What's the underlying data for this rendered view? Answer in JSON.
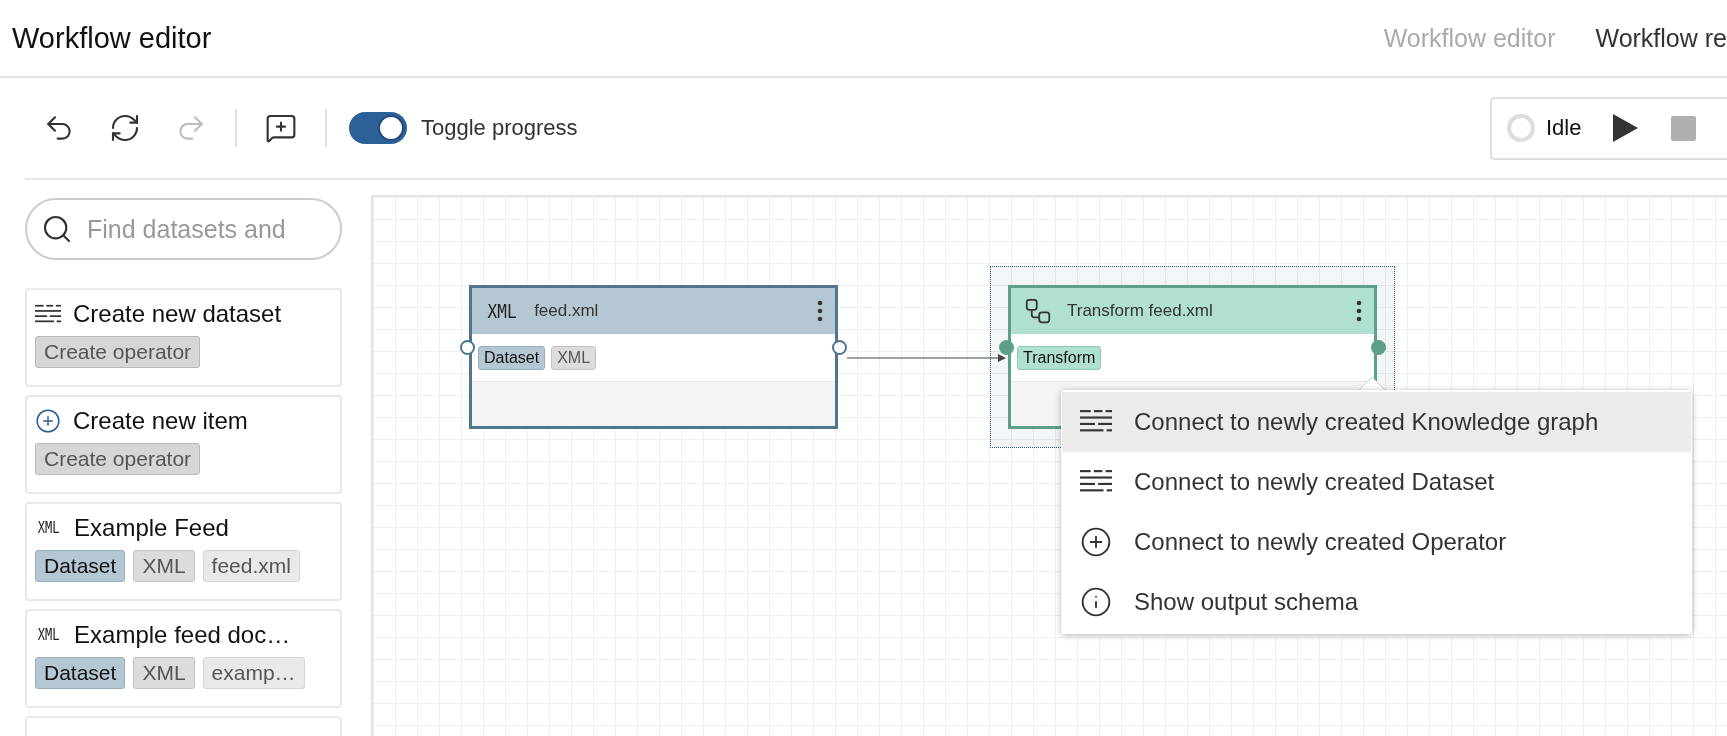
{
  "header": {
    "title": "Workflow editor",
    "tabs": [
      {
        "label": "Workflow editor",
        "selected": false
      },
      {
        "label": "Workflow re",
        "selected": true
      }
    ]
  },
  "toolbar": {
    "tools": [
      {
        "kind": "undo",
        "disabled": false
      },
      {
        "kind": "refresh",
        "disabled": false
      },
      {
        "kind": "redo",
        "disabled": true
      },
      {
        "kind": "comment",
        "disabled": false
      }
    ],
    "toggle": {
      "label": "Toggle progress",
      "on": true
    },
    "status": {
      "label": "Idle"
    }
  },
  "sidebar": {
    "search": {
      "placeholder": "Find datasets and"
    },
    "items": [
      {
        "kind": "dataset",
        "title": "Create new dataset",
        "tags": [
          {
            "kind": "operator",
            "label": "Create operator"
          }
        ]
      },
      {
        "kind": "create",
        "title": "Create new item",
        "tags": [
          {
            "kind": "operator",
            "label": "Create operator"
          }
        ]
      },
      {
        "kind": "xml",
        "icon_text": "XML",
        "title": "Example Feed",
        "tags": [
          {
            "kind": "dataset",
            "label": "Dataset"
          },
          {
            "kind": "type",
            "label": "XML"
          },
          {
            "kind": "plain",
            "label": "feed.xml"
          }
        ]
      },
      {
        "kind": "xml",
        "icon_text": "XML",
        "title": "Example feed doc…",
        "tags": [
          {
            "kind": "dataset",
            "label": "Dataset"
          },
          {
            "kind": "type",
            "label": "XML"
          },
          {
            "kind": "plain",
            "label": "examp…"
          }
        ]
      }
    ]
  },
  "canvas": {
    "nodes": [
      {
        "kind": "dataset",
        "icon_text": "XML",
        "title": "feed.xml",
        "selected": false,
        "tags": [
          {
            "kind": "dataset",
            "label": "Dataset"
          },
          {
            "kind": "type",
            "label": "XML"
          }
        ]
      },
      {
        "kind": "transform",
        "title": "Transform feed.xml",
        "selected": true,
        "tags": [
          {
            "kind": "transform",
            "label": "Transform"
          }
        ]
      }
    ],
    "menu": [
      {
        "kind": "dataset",
        "label": "Connect to newly created Knowledge graph",
        "selected": true
      },
      {
        "kind": "dataset",
        "label": "Connect to newly created Dataset",
        "selected": false
      },
      {
        "kind": "create",
        "label": "Connect to newly created Operator",
        "selected": false
      },
      {
        "kind": "info",
        "label": "Show output schema",
        "selected": false
      }
    ]
  }
}
